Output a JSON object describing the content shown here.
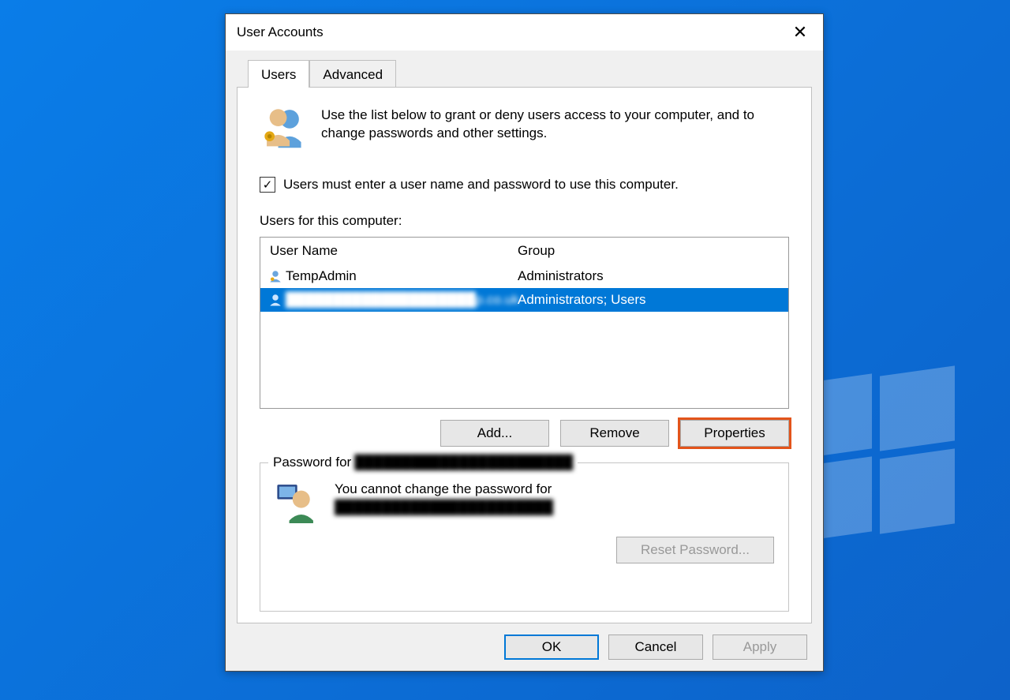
{
  "dialog": {
    "title": "User Accounts",
    "close_icon": "✕"
  },
  "tabs": {
    "users": "Users",
    "advanced": "Advanced"
  },
  "intro_text": "Use the list below to grant or deny users access to your computer, and to change passwords and other settings.",
  "checkbox": {
    "checked": true,
    "label": "Users must enter a user name and password to use this computer."
  },
  "users_list": {
    "label": "Users for this computer:",
    "columns": {
      "user": "User Name",
      "group": "Group"
    },
    "rows": [
      {
        "user": "TempAdmin",
        "group": "Administrators",
        "selected": false,
        "user_blurred": false
      },
      {
        "user": "████████████████████p.co.uk",
        "group": "Administrators; Users",
        "selected": true,
        "user_blurred": true
      }
    ]
  },
  "buttons": {
    "add": "Add...",
    "remove": "Remove",
    "properties": "Properties"
  },
  "password_group": {
    "legend_prefix": "Password for ",
    "legend_user": "███████████████████████",
    "text_line1": "You cannot change the password for",
    "text_line2": "███████████████████████",
    "reset": "Reset Password..."
  },
  "footer": {
    "ok": "OK",
    "cancel": "Cancel",
    "apply": "Apply"
  }
}
